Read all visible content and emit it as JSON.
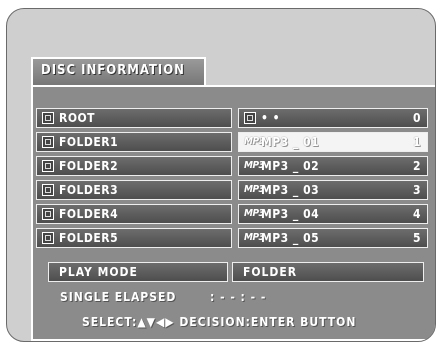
{
  "title": "DISC INFORMATION",
  "folders": [
    {
      "label": "ROOT"
    },
    {
      "label": "FOLDER1"
    },
    {
      "label": "FOLDER2"
    },
    {
      "label": "FOLDER3"
    },
    {
      "label": "FOLDER4"
    },
    {
      "label": "FOLDER5"
    }
  ],
  "files": [
    {
      "icon": "folder-icon",
      "label": "• •",
      "num": "0"
    },
    {
      "icon": "mp3-icon",
      "label": "MP3 _ 01",
      "num": "1",
      "selected": true
    },
    {
      "icon": "mp3-icon",
      "label": "MP3 _ 02",
      "num": "2"
    },
    {
      "icon": "mp3-icon",
      "label": "MP3 _ 03",
      "num": "3"
    },
    {
      "icon": "mp3-icon",
      "label": "MP3 _ 04",
      "num": "4"
    },
    {
      "icon": "mp3-icon",
      "label": "MP3 _ 05",
      "num": "5"
    }
  ],
  "mp3_icon_text": "MP3",
  "play_mode": {
    "label": "PLAY MODE",
    "value": "FOLDER"
  },
  "elapsed": {
    "label": "SINGLE ELAPSED",
    "value": ": - - : - -"
  },
  "hint": "SELECT:▲▼◀▶ DECISION:ENTER BUTTON"
}
